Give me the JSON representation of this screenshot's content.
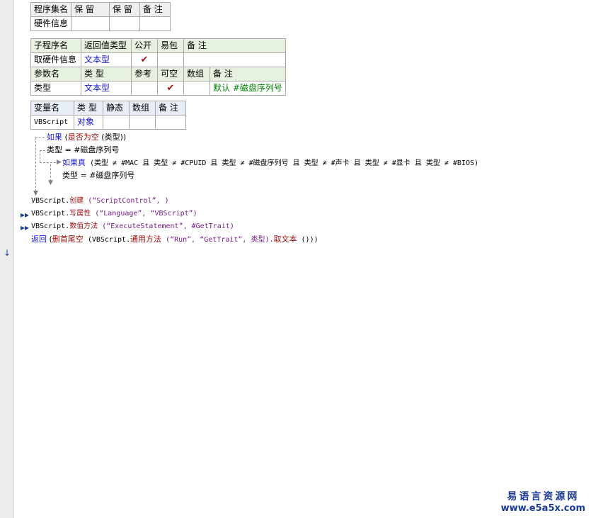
{
  "assembly_table": {
    "headers": [
      "程序集名",
      "保 留",
      "保 留",
      "备 注"
    ],
    "row": [
      "硬件信息",
      "",
      "",
      ""
    ]
  },
  "sub_table": {
    "headers": [
      "子程序名",
      "返回值类型",
      "公开",
      "易包",
      "备 注"
    ],
    "row": [
      "取硬件信息",
      "文本型",
      "✔",
      "",
      ""
    ],
    "param_headers": [
      "参数名",
      "类 型",
      "参考",
      "可空",
      "数组",
      "备 注"
    ],
    "param_row": [
      "类型",
      "文本型",
      "",
      "✔",
      "",
      "默认 #磁盘序列号"
    ]
  },
  "var_table": {
    "headers": [
      "变量名",
      "类 型",
      "静态",
      "数组",
      "备 注"
    ],
    "row": [
      "VBScript",
      "对象",
      "",
      "",
      ""
    ]
  },
  "code": {
    "if_kw": "如果",
    "if_fn": "是否为空",
    "if_arg": "(类型))",
    "assign1_var": "类型",
    "assign1_rest": " = #磁盘序列号",
    "ifreal_kw": "如果真",
    "ifreal_cond": " (类型 ≠ #MAC 且 类型 ≠ #CPUID 且 类型 ≠ #磁盘序列号 且 类型 ≠ #声卡 且 类型 ≠ #显卡 且 类型 ≠ #BIOS)",
    "assign2_var": "类型",
    "assign2_rest": " = #磁盘序列号",
    "l1_obj": "VBScript.",
    "l1_fn": "创建",
    "l1_args": " (“ScriptControl”, )",
    "l2_obj": "VBScript.",
    "l2_fn": "写属性",
    "l2_args": " (“Language”, “VBScript”)",
    "l3_obj": "VBScript.",
    "l3_fn": "数值方法",
    "l3_args": " (“ExecuteStatement”, #GetTrait)",
    "l4_kw": "返回",
    "l4_fn": "删首尾空",
    "l4_a": " (VBScript.",
    "l4_fn2": "通用方法",
    "l4_b": " (“Run”, “GetTrait”, 类型).",
    "l4_fn3": "取文本",
    "l4_c": " ()))"
  },
  "gutter_marks": [
    "▸▸",
    "▸▸",
    "↓"
  ],
  "watermark": {
    "title": "易语言资源网",
    "url": "www.e5a5x.com"
  }
}
